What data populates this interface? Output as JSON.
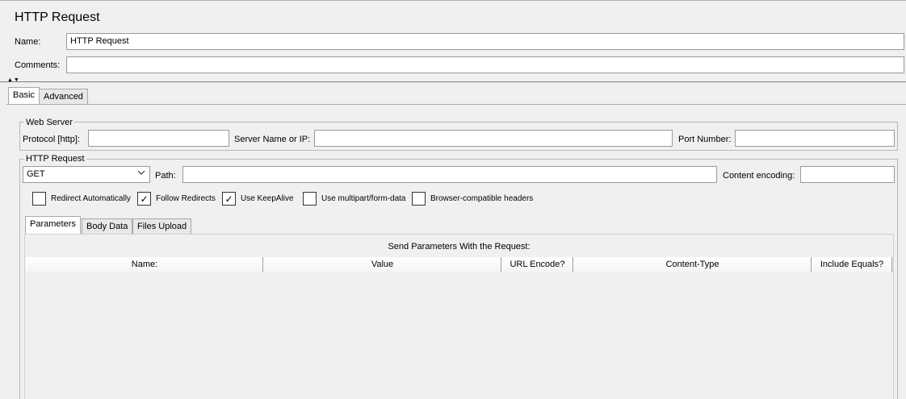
{
  "header": {
    "title": "HTTP Request",
    "name_label": "Name:",
    "name_value": "HTTP Request",
    "comments_label": "Comments:",
    "comments_value": ""
  },
  "tabs": [
    {
      "label": "Basic",
      "active": true
    },
    {
      "label": "Advanced",
      "active": false
    }
  ],
  "web_server": {
    "title": "Web Server",
    "protocol_label": "Protocol [http]:",
    "protocol_value": "",
    "server_label": "Server Name or IP:",
    "server_value": "",
    "port_label": "Port Number:",
    "port_value": ""
  },
  "http_request": {
    "title": "HTTP Request",
    "method": "GET",
    "path_label": "Path:",
    "path_value": "",
    "encoding_label": "Content encoding:",
    "encoding_value": ""
  },
  "checkboxes": [
    {
      "label": "Redirect Automatically",
      "checked": false
    },
    {
      "label": "Follow Redirects",
      "checked": true
    },
    {
      "label": "Use KeepAlive",
      "checked": true
    },
    {
      "label": "Use multipart/form-data",
      "checked": false
    },
    {
      "label": "Browser-compatible headers",
      "checked": false
    }
  ],
  "param_tabs": [
    {
      "label": "Parameters",
      "active": true
    },
    {
      "label": "Body Data",
      "active": false
    },
    {
      "label": "Files Upload",
      "active": false
    }
  ],
  "params_table": {
    "caption": "Send Parameters With the Request:",
    "columns": [
      "Name:",
      "Value",
      "URL Encode?",
      "Content-Type",
      "Include Equals?"
    ],
    "rows": []
  },
  "icons": {
    "splitter": "splitter-arrows-icon",
    "combo_arrow": "chevron-down-icon",
    "check": "checkmark-icon"
  }
}
